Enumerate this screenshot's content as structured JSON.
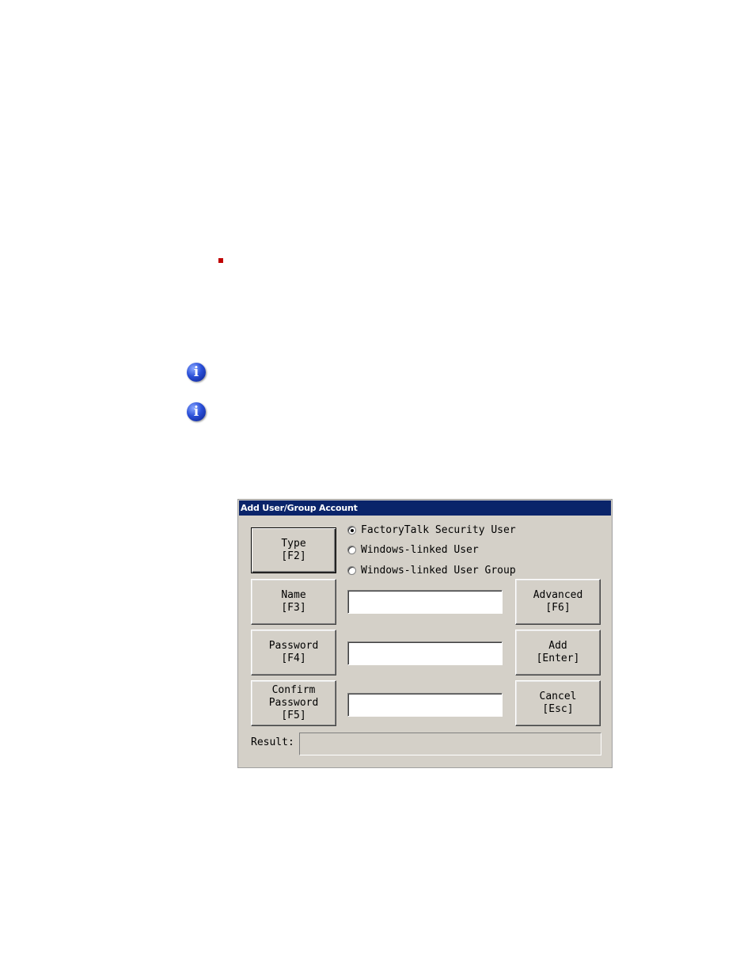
{
  "dialog": {
    "title": "Add User/Group Account",
    "buttons": {
      "type": "Type\n[F2]",
      "name": "Name\n[F3]",
      "password": "Password\n[F4]",
      "confirm_password": "Confirm\nPassword\n[F5]",
      "advanced": "Advanced\n[F6]",
      "add": "Add\n[Enter]",
      "cancel": "Cancel\n[Esc]"
    },
    "account_types": [
      {
        "label": "FactoryTalk Security User",
        "selected": true
      },
      {
        "label": "Windows-linked User",
        "selected": false
      },
      {
        "label": "Windows-linked User Group",
        "selected": false
      }
    ],
    "fields": {
      "name_value": "",
      "password_value": "",
      "confirm_password_value": ""
    },
    "result": {
      "label": "Result:",
      "value": ""
    }
  },
  "icons": {
    "bullet": "square-bullet-icon",
    "info": "info-icon",
    "info_glyph": "i"
  },
  "colors": {
    "titlebar": "#0a246a",
    "dialog_bg": "#d4d0c8",
    "bullet": "#c00000",
    "info_icon": "#2a4fd8"
  }
}
